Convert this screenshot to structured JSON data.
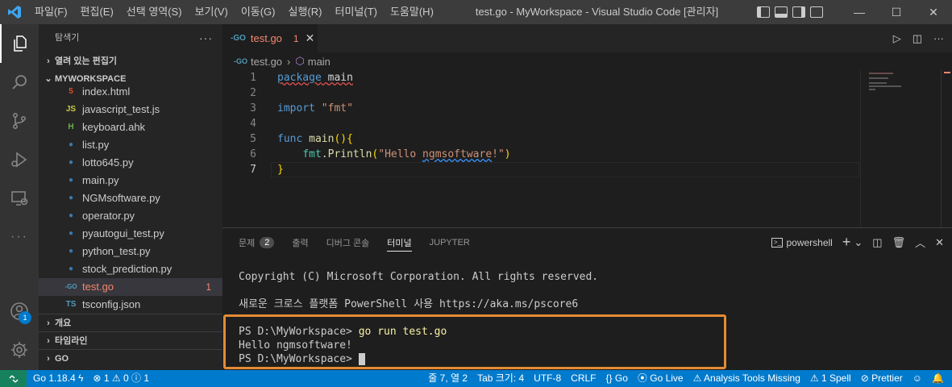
{
  "titlebar": {
    "menu": [
      "파일(F)",
      "편집(E)",
      "선택 영역(S)",
      "보기(V)",
      "이동(G)",
      "실행(R)",
      "터미널(T)",
      "도움말(H)"
    ],
    "title": "test.go - MyWorkspace - Visual Studio Code [관리자]",
    "controls": {
      "minimize": "—",
      "maximize": "☐",
      "close": "✕"
    }
  },
  "activity": {
    "accounts_badge": "1"
  },
  "sidebar": {
    "header": "탐색기",
    "more": "···",
    "open_editors": "열려 있는 편집기",
    "workspace": "MYWORKSPACE",
    "files": [
      {
        "name": "index.html",
        "icon": "html-icon",
        "glyph": "5",
        "color": "#e44d26"
      },
      {
        "name": "javascript_test.js",
        "icon": "js-icon",
        "glyph": "JS",
        "color": "#cbcb41"
      },
      {
        "name": "keyboard.ahk",
        "icon": "ahk-icon",
        "glyph": "H",
        "color": "#6ab04c"
      },
      {
        "name": "list.py",
        "icon": "python-icon",
        "glyph": "●",
        "color": "#3b78b0"
      },
      {
        "name": "lotto645.py",
        "icon": "python-icon",
        "glyph": "●",
        "color": "#3b78b0"
      },
      {
        "name": "main.py",
        "icon": "python-icon",
        "glyph": "●",
        "color": "#3b78b0"
      },
      {
        "name": "NGMsoftware.py",
        "icon": "python-icon",
        "glyph": "●",
        "color": "#3b78b0"
      },
      {
        "name": "operator.py",
        "icon": "python-icon",
        "glyph": "●",
        "color": "#3b78b0"
      },
      {
        "name": "pyautogui_test.py",
        "icon": "python-icon",
        "glyph": "●",
        "color": "#3b78b0"
      },
      {
        "name": "python_test.py",
        "icon": "python-icon",
        "glyph": "●",
        "color": "#3b78b0"
      },
      {
        "name": "stock_prediction.py",
        "icon": "python-icon",
        "glyph": "●",
        "color": "#3b78b0"
      },
      {
        "name": "test.go",
        "icon": "go-icon",
        "glyph": "-GO",
        "color": "#519aba",
        "selected": true,
        "errors": "1"
      },
      {
        "name": "tsconfig.json",
        "icon": "ts-icon",
        "glyph": "TS",
        "color": "#519aba"
      }
    ],
    "outline": "개요",
    "timeline": "타임라인",
    "go": "GO"
  },
  "editor": {
    "tab": {
      "name": "test.go",
      "problems": "1",
      "close": "✕"
    },
    "breadcrumbs": {
      "file": "test.go",
      "symbol": "main"
    },
    "lines": [
      "1",
      "2",
      "3",
      "4",
      "5",
      "6",
      "7"
    ],
    "code": {
      "l1_kw": "package",
      "l1_name": "main",
      "l3_kw": "import",
      "l3_str": "\"fmt\"",
      "l5_kw": "func",
      "l5_fn": "main",
      "l5_paren": "()",
      "l5_brace": "{",
      "l6_pkg": "fmt",
      "l6_fn": "Println",
      "l6_str_a": "\"Hello ",
      "l6_str_b": "ngmsoftware",
      "l6_str_c": "!\"",
      "l7_brace": "}"
    }
  },
  "panel": {
    "tabs": [
      {
        "label": "문제",
        "badge": "2"
      },
      {
        "label": "출력"
      },
      {
        "label": "디버그 콘솔"
      },
      {
        "label": "터미널",
        "active": true
      },
      {
        "label": "JUPYTER"
      }
    ],
    "shell": "powershell",
    "terminal": {
      "line1": "Copyright (C) Microsoft Corporation. All rights reserved.",
      "line2": "새로운 크로스 플랫폼 PowerShell 사용 https://aka.ms/pscore6",
      "prompt1": "PS D:\\MyWorkspace> ",
      "cmd1": "go run test.go",
      "output": "Hello ngmsoftware!",
      "prompt2": "PS D:\\MyWorkspace> "
    }
  },
  "statusbar": {
    "go_version": "Go 1.18.4",
    "errors": "1",
    "warnings": "0",
    "info": "1",
    "position": "줄 7, 열 2",
    "tab_size": "Tab 크기: 4",
    "encoding": "UTF-8",
    "eol": "CRLF",
    "language": "Go",
    "golive": "Go Live",
    "analysis": "Analysis Tools Missing",
    "spell": "1 Spell",
    "prettier": "Prettier"
  }
}
